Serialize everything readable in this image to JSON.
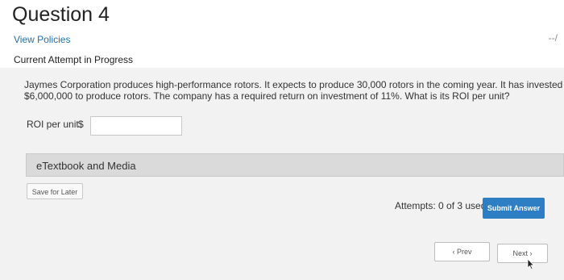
{
  "question": {
    "title": "Question 4",
    "points": "--/",
    "view_policies": "View Policies",
    "attempt_status": "Current Attempt in Progress",
    "text": "Jaymes Corporation produces high-performance rotors. It expects to produce 30,000 rotors in the coming year. It has invested $6,000,000 to produce rotors. The company has a required return on investment of 11%. What is its ROI per unit?"
  },
  "answer": {
    "label": "ROI per unit",
    "currency": "$",
    "value": ""
  },
  "etextbook": {
    "label": "eTextbook and Media"
  },
  "actions": {
    "save_later": "Save for Later",
    "attempts": "Attempts: 0 of 3 used",
    "submit": "Submit Answer"
  },
  "nav": {
    "prev": "‹ Prev",
    "next": "Next ›"
  },
  "colors": {
    "link": "#1f6fb2",
    "submit": "#2e7ec4",
    "panel": "#f2f2f2",
    "etext_bar": "#d9dad9"
  }
}
